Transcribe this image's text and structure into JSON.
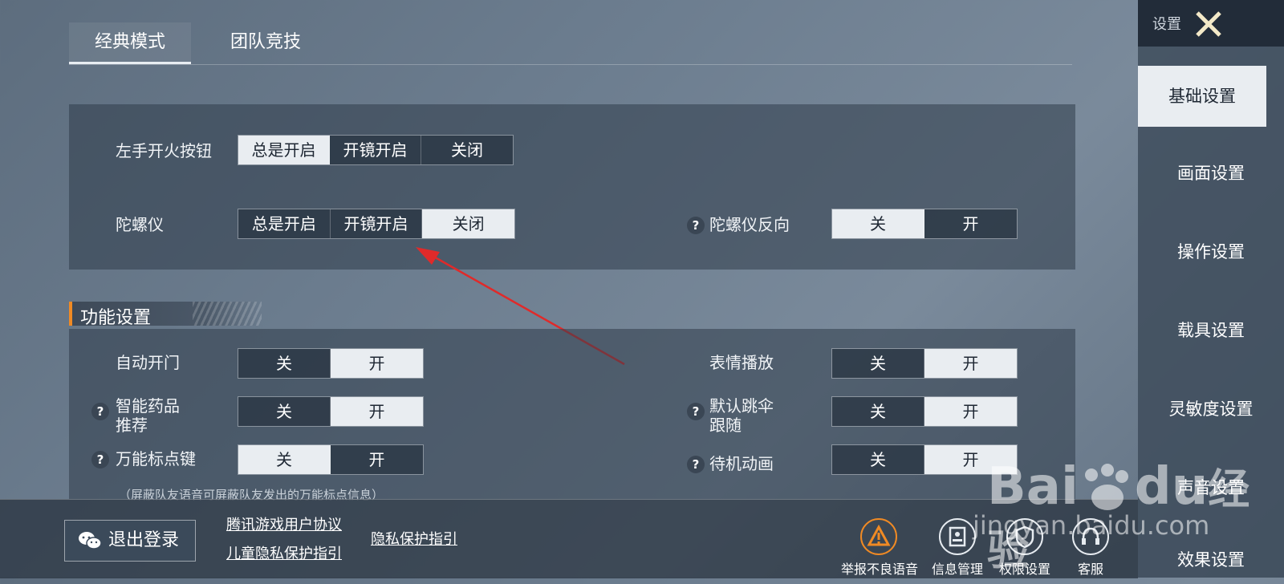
{
  "tabs": [
    {
      "label": "经典模式",
      "active": true
    },
    {
      "label": "团队竞技",
      "active": false
    }
  ],
  "top_panel": {
    "rows": [
      {
        "label": "左手开火按钮",
        "options": [
          "总是开启",
          "开镜开启",
          "关闭"
        ],
        "selected": 0
      },
      {
        "label": "陀螺仪",
        "options": [
          "总是开启",
          "开镜开启",
          "关闭"
        ],
        "selected": 2
      }
    ],
    "gyro_invert": {
      "label": "陀螺仪反向",
      "options": [
        "关",
        "开"
      ],
      "selected": 0
    }
  },
  "section": {
    "title": "功能设置",
    "left_rows": [
      {
        "label": "自动开门",
        "help": false,
        "options": [
          "关",
          "开"
        ],
        "selected": 1
      },
      {
        "label": "智能药品\n推荐",
        "help": true,
        "options": [
          "关",
          "开"
        ],
        "selected": 1
      },
      {
        "label": "万能标点键",
        "help": true,
        "options": [
          "关",
          "开"
        ],
        "selected": 0
      }
    ],
    "right_rows": [
      {
        "label": "表情播放",
        "help": false,
        "options": [
          "关",
          "开"
        ],
        "selected": 1
      },
      {
        "label": "默认跳伞\n跟随",
        "help": true,
        "options": [
          "关",
          "开"
        ],
        "selected": 1
      },
      {
        "label": "待机动画",
        "help": true,
        "options": [
          "关",
          "开"
        ],
        "selected": 1
      }
    ],
    "note": "（屏蔽队友语音可屏蔽队友发出的万能标点信息）"
  },
  "bottom": {
    "logout_label": "退出登录",
    "links": [
      "腾讯游戏用户协议",
      "儿童隐私保护指引",
      "隐私保护指引"
    ],
    "actions": [
      {
        "label": "举报不良语音",
        "icon": "warning-icon"
      },
      {
        "label": "信息管理",
        "icon": "id-card-icon"
      },
      {
        "label": "权限设置",
        "icon": "shield-icon"
      },
      {
        "label": "客服",
        "icon": "headset-icon"
      }
    ]
  },
  "sidebar": {
    "title": "设置",
    "items": [
      "基础设置",
      "画面设置",
      "操作设置",
      "载具设置",
      "灵敏度设置",
      "声音设置",
      "效果设置"
    ],
    "active_index": 0
  },
  "watermark": {
    "brand": "Bai",
    "brand2": "du",
    "cn": "经验",
    "url": "jingyan.baidu.com"
  },
  "colors": {
    "accent": "#f08a24",
    "selected_bg": "#e9edf1",
    "warning": "#f08a24"
  }
}
